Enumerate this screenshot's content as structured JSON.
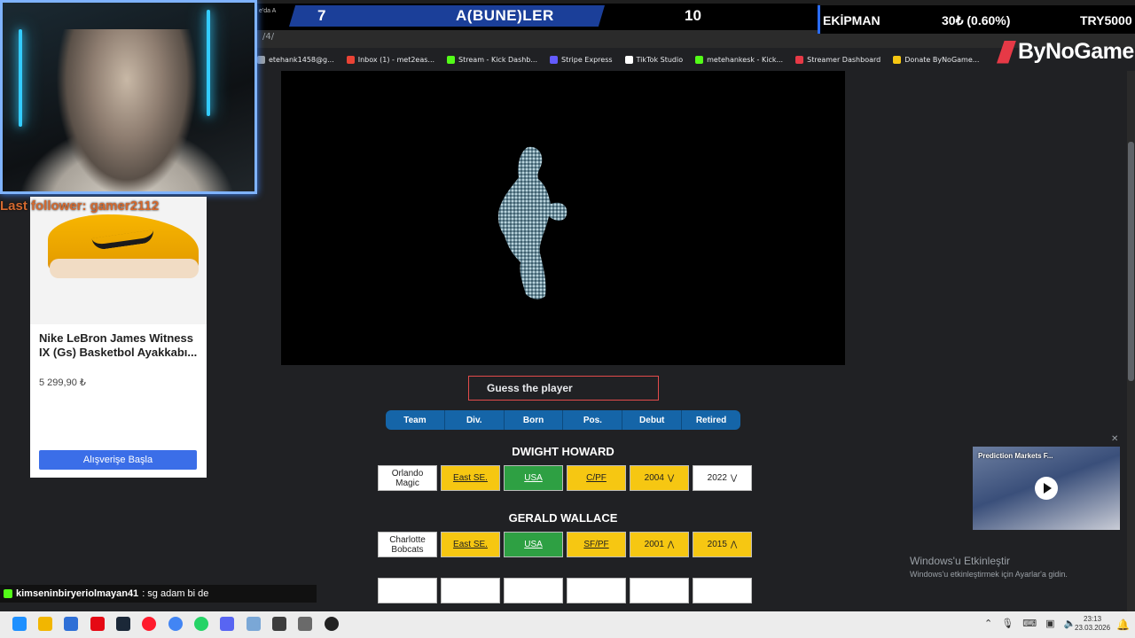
{
  "overlay": {
    "score_sub": "e'da A",
    "score_left": "7",
    "score_title": "A(BUNE)LER",
    "score_right": "10",
    "equipment_label": "EKİPMAN",
    "equipment_value": "30₺ (0.60%)",
    "equipment_currency": "TRY5000",
    "brand": "ByNoGame",
    "last_follower": "Last follower: gamer2112"
  },
  "browser": {
    "address_fragment": "/4/",
    "bookmarks": [
      {
        "label": "etehank1458@g...",
        "color": "#9aa0a6"
      },
      {
        "label": "Inbox (1) - met2eas...",
        "color": "#ea4335"
      },
      {
        "label": "Stream - Kick Dashb...",
        "color": "#53fc18"
      },
      {
        "label": "Stripe Express",
        "color": "#635bff"
      },
      {
        "label": "TikTok Studio",
        "color": "#ffffff"
      },
      {
        "label": "metehankesk - Kick...",
        "color": "#53fc18"
      },
      {
        "label": "Streamer Dashboard",
        "color": "#e63946"
      },
      {
        "label": "Donate ByNoGame...",
        "color": "#f6c712"
      }
    ]
  },
  "ad": {
    "title": "Nike LeBron James Witness IX (Gs) Basketbol Ayakkabı...",
    "price": "5 299,90 ₺",
    "button": "Alışverişe Başla"
  },
  "game": {
    "guess_placeholder": "Guess the player",
    "headers": [
      "Team",
      "Div.",
      "Born",
      "Pos.",
      "Debut",
      "Retired"
    ],
    "guesses": [
      {
        "name": "DWIGHT HOWARD",
        "cells": [
          {
            "text": "Orlando Magic",
            "color": "white",
            "arrow": ""
          },
          {
            "text": "East SE.",
            "color": "yellow",
            "arrow": ""
          },
          {
            "text": "USA",
            "color": "green",
            "arrow": ""
          },
          {
            "text": "C/PF",
            "color": "yellow",
            "arrow": ""
          },
          {
            "text": "2004",
            "color": "yellow",
            "arrow": "down"
          },
          {
            "text": "2022",
            "color": "white",
            "arrow": "down"
          }
        ]
      },
      {
        "name": "GERALD WALLACE",
        "cells": [
          {
            "text": "Charlotte Bobcats",
            "color": "white",
            "arrow": ""
          },
          {
            "text": "East SE.",
            "color": "yellow",
            "arrow": ""
          },
          {
            "text": "USA",
            "color": "green",
            "arrow": ""
          },
          {
            "text": "SF/PF",
            "color": "yellow",
            "arrow": ""
          },
          {
            "text": "2001",
            "color": "yellow",
            "arrow": "up"
          },
          {
            "text": "2015",
            "color": "yellow",
            "arrow": "up"
          }
        ]
      }
    ]
  },
  "video": {
    "title": "Prediction Markets F..."
  },
  "windows": {
    "activate_title": "Windows'u Etkinleştir",
    "activate_sub": "Windows'u etkinleştirmek için Ayarlar'a gidin.",
    "time": "23:13",
    "date": "23.03.2026"
  },
  "chat": {
    "user": "kimseninbiryeriolmayan41",
    "message": ": sg adam bi de"
  },
  "colors": {
    "correct": "#2ea043",
    "partial": "#f6c712",
    "wrong": "#ffffff",
    "header": "#1565a8",
    "accent": "#e24b4b"
  }
}
